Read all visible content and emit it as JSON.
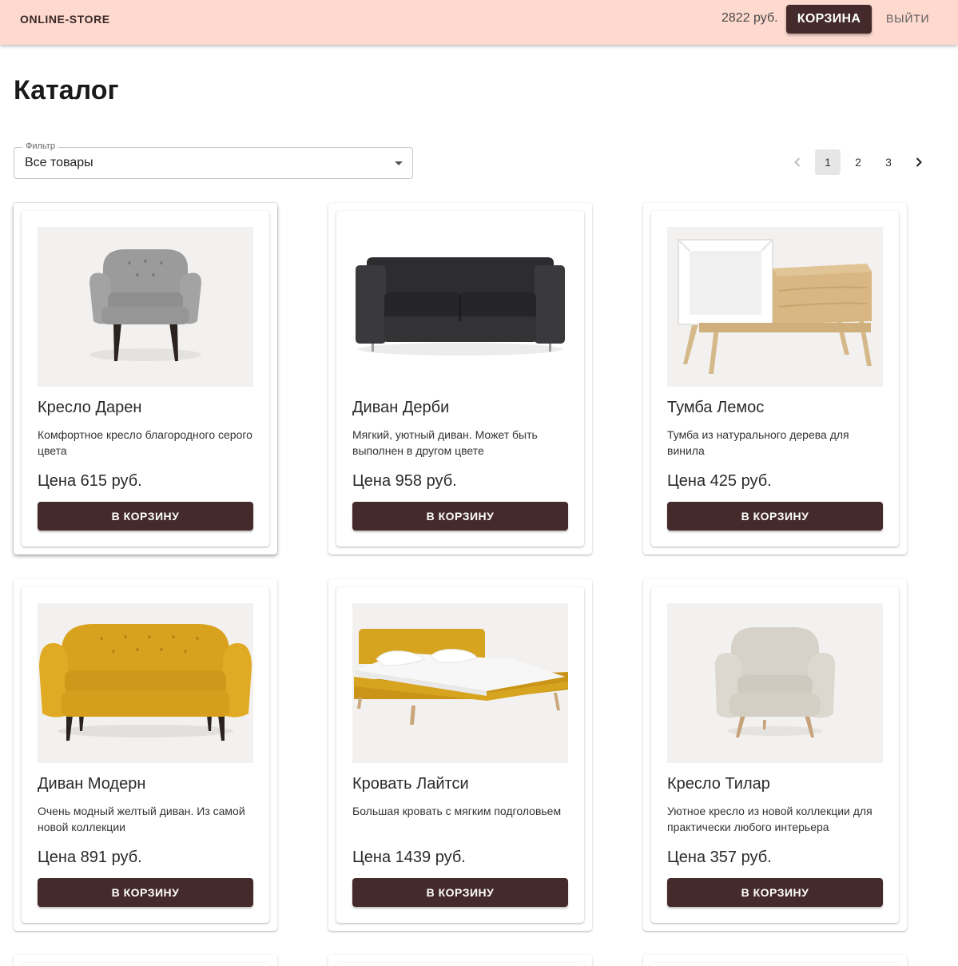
{
  "header": {
    "logo": "ONLINE-STORE",
    "balance": "2822 руб.",
    "cart_label": "КОРЗИНА",
    "logout_label": "ВЫЙТИ",
    "background_color": "#fdd9ce",
    "accent_color": "#442a2a"
  },
  "page": {
    "title": "Каталог"
  },
  "filter": {
    "label": "Фильтр",
    "value": "Все товары"
  },
  "pagination": {
    "pages": [
      "1",
      "2",
      "3"
    ],
    "current": "1"
  },
  "products": [
    {
      "title": "Кресло Дарен",
      "description": "Комфортное кресло благородного серого цвета",
      "price": "Цена 615 руб.",
      "button": "В КОРЗИНУ",
      "image": "gray-armchair"
    },
    {
      "title": "Диван Дерби",
      "description": "Мягкий, уютный диван. Может быть выполнен в другом цвете",
      "price": "Цена 958 руб.",
      "button": "В КОРЗИНУ",
      "image": "black-sofa"
    },
    {
      "title": "Тумба Лемос",
      "description": "Тумба из натурального дерева для винила",
      "price": "Цена 425 руб.",
      "button": "В КОРЗИНУ",
      "image": "wooden-cabinet"
    },
    {
      "title": "Диван Модерн",
      "description": "Очень модный желтый диван. Из самой новой коллекции",
      "price": "Цена 891 руб.",
      "button": "В КОРЗИНУ",
      "image": "yellow-sofa"
    },
    {
      "title": "Кровать Лайтси",
      "description": "Большая кровать с мягким подголовьем",
      "price": "Цена 1439 руб.",
      "button": "В КОРЗИНУ",
      "image": "yellow-bed"
    },
    {
      "title": "Кресло Тилар",
      "description": "Уютное кресло из новой коллекции для практически любого интерьера",
      "price": "Цена 357 руб.",
      "button": "В КОРЗИНУ",
      "image": "beige-armchair"
    }
  ]
}
